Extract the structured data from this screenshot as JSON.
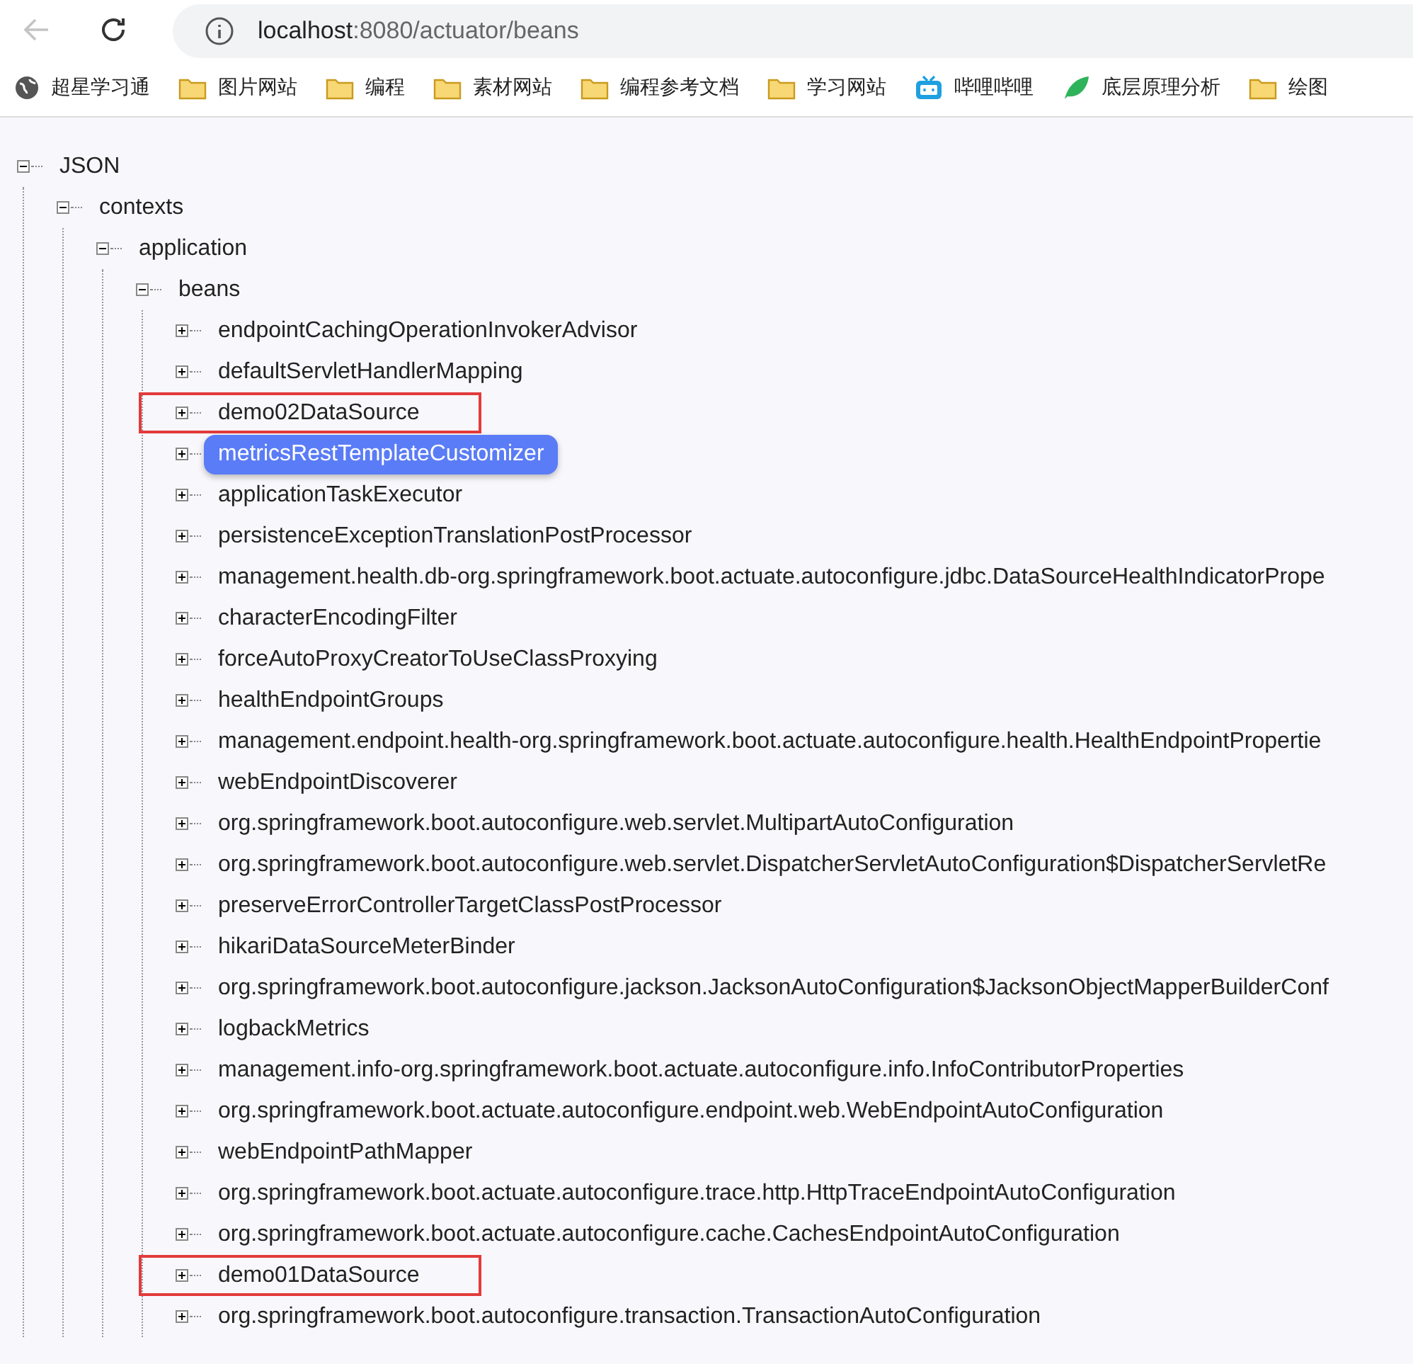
{
  "toolbar": {
    "back_button": {
      "disabled": true
    },
    "url_host": "localhost",
    "url_path": ":8080/actuator/beans"
  },
  "bookmarks": [
    {
      "kind": "globe",
      "label": "超星学习通"
    },
    {
      "kind": "folder",
      "label": "图片网站"
    },
    {
      "kind": "folder",
      "label": "编程"
    },
    {
      "kind": "folder",
      "label": "素材网站"
    },
    {
      "kind": "folder",
      "label": "编程参考文档"
    },
    {
      "kind": "folder",
      "label": "学习网站"
    },
    {
      "kind": "tv",
      "label": "哔哩哔哩"
    },
    {
      "kind": "leaf",
      "label": "底层原理分析"
    },
    {
      "kind": "folder",
      "label": "绘图"
    }
  ],
  "tree": [
    {
      "label": "JSON",
      "expanded": true,
      "selected": false,
      "children": [
        {
          "label": "contexts",
          "expanded": true,
          "selected": false,
          "children": [
            {
              "label": "application",
              "expanded": true,
              "selected": false,
              "children": [
                {
                  "label": "beans",
                  "expanded": true,
                  "selected": false,
                  "children": [
                    {
                      "label": "endpointCachingOperationInvokerAdvisor",
                      "expanded": false,
                      "selected": false,
                      "highlighted": false
                    },
                    {
                      "label": "defaultServletHandlerMapping",
                      "expanded": false,
                      "selected": false,
                      "highlighted": false
                    },
                    {
                      "label": "demo02DataSource",
                      "expanded": false,
                      "selected": false,
                      "highlighted": true
                    },
                    {
                      "label": "metricsRestTemplateCustomizer",
                      "expanded": false,
                      "selected": true,
                      "highlighted": false
                    },
                    {
                      "label": "applicationTaskExecutor",
                      "expanded": false,
                      "selected": false,
                      "highlighted": false
                    },
                    {
                      "label": "persistenceExceptionTranslationPostProcessor",
                      "expanded": false,
                      "selected": false,
                      "highlighted": false
                    },
                    {
                      "label": "management.health.db-org.springframework.boot.actuate.autoconfigure.jdbc.DataSourceHealthIndicatorPrope",
                      "expanded": false,
                      "selected": false,
                      "highlighted": false
                    },
                    {
                      "label": "characterEncodingFilter",
                      "expanded": false,
                      "selected": false,
                      "highlighted": false
                    },
                    {
                      "label": "forceAutoProxyCreatorToUseClassProxying",
                      "expanded": false,
                      "selected": false,
                      "highlighted": false
                    },
                    {
                      "label": "healthEndpointGroups",
                      "expanded": false,
                      "selected": false,
                      "highlighted": false
                    },
                    {
                      "label": "management.endpoint.health-org.springframework.boot.actuate.autoconfigure.health.HealthEndpointPropertie",
                      "expanded": false,
                      "selected": false,
                      "highlighted": false
                    },
                    {
                      "label": "webEndpointDiscoverer",
                      "expanded": false,
                      "selected": false,
                      "highlighted": false
                    },
                    {
                      "label": "org.springframework.boot.autoconfigure.web.servlet.MultipartAutoConfiguration",
                      "expanded": false,
                      "selected": false,
                      "highlighted": false
                    },
                    {
                      "label": "org.springframework.boot.autoconfigure.web.servlet.DispatcherServletAutoConfiguration$DispatcherServletRe",
                      "expanded": false,
                      "selected": false,
                      "highlighted": false
                    },
                    {
                      "label": "preserveErrorControllerTargetClassPostProcessor",
                      "expanded": false,
                      "selected": false,
                      "highlighted": false
                    },
                    {
                      "label": "hikariDataSourceMeterBinder",
                      "expanded": false,
                      "selected": false,
                      "highlighted": false
                    },
                    {
                      "label": "org.springframework.boot.autoconfigure.jackson.JacksonAutoConfiguration$JacksonObjectMapperBuilderConf",
                      "expanded": false,
                      "selected": false,
                      "highlighted": false
                    },
                    {
                      "label": "logbackMetrics",
                      "expanded": false,
                      "selected": false,
                      "highlighted": false
                    },
                    {
                      "label": "management.info-org.springframework.boot.actuate.autoconfigure.info.InfoContributorProperties",
                      "expanded": false,
                      "selected": false,
                      "highlighted": false
                    },
                    {
                      "label": "org.springframework.boot.actuate.autoconfigure.endpoint.web.WebEndpointAutoConfiguration",
                      "expanded": false,
                      "selected": false,
                      "highlighted": false
                    },
                    {
                      "label": "webEndpointPathMapper",
                      "expanded": false,
                      "selected": false,
                      "highlighted": false
                    },
                    {
                      "label": "org.springframework.boot.actuate.autoconfigure.trace.http.HttpTraceEndpointAutoConfiguration",
                      "expanded": false,
                      "selected": false,
                      "highlighted": false
                    },
                    {
                      "label": "org.springframework.boot.actuate.autoconfigure.cache.CachesEndpointAutoConfiguration",
                      "expanded": false,
                      "selected": false,
                      "highlighted": false
                    },
                    {
                      "label": "demo01DataSource",
                      "expanded": false,
                      "selected": false,
                      "highlighted": true
                    },
                    {
                      "label": "org.springframework.boot.autoconfigure.transaction.TransactionAutoConfiguration",
                      "expanded": false,
                      "selected": false,
                      "highlighted": false
                    }
                  ]
                }
              ]
            }
          ]
        }
      ]
    }
  ]
}
